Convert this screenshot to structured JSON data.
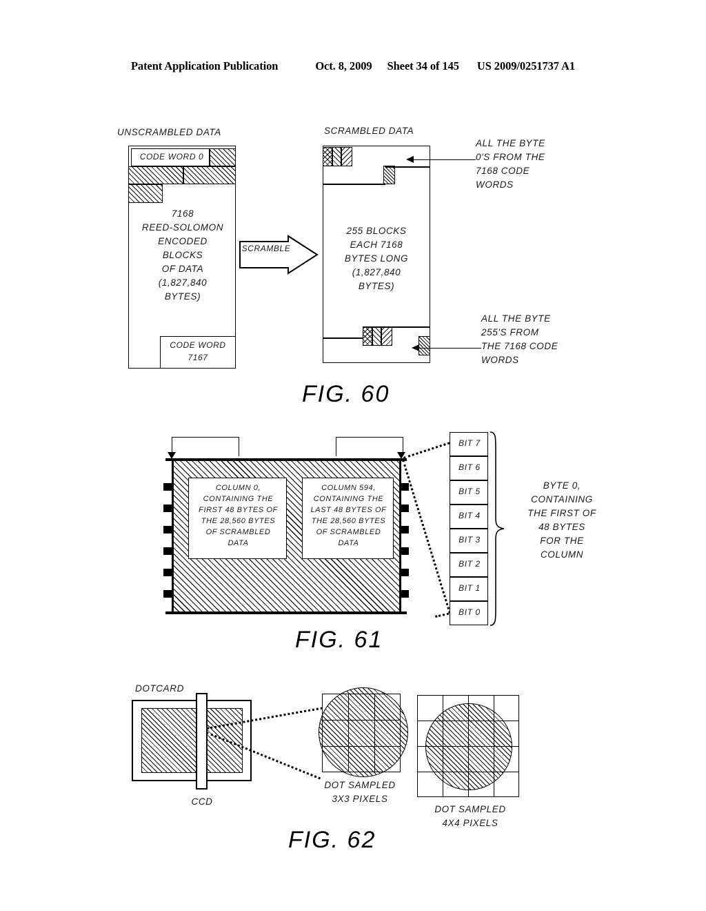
{
  "header": {
    "title": "Patent Application Publication",
    "date": "Oct. 8, 2009",
    "sheet": "Sheet 34 of 145",
    "patent_number": "US 2009/0251737 A1"
  },
  "fig60": {
    "label": "FIG. 60",
    "left_caption": "UNSCRAMBLED DATA",
    "right_caption": "SCRAMBLED DATA",
    "left_top_block_label": "CODE WORD 0",
    "left_body_text": "7168\nREED-SOLOMON\nENCODED\nBLOCKS\nOF DATA\n(1,827,840\nBYTES)",
    "left_bottom_block_label": "CODE WORD\n7167",
    "right_body_text": "255 BLOCKS\nEACH 7168\nBYTES LONG\n(1,827,840\nBYTES)",
    "scramble_arrow_label": "SCRAMBLE",
    "annotation_top": "ALL THE BYTE\n0'S FROM THE\n7168 CODE\nWORDS",
    "annotation_bottom": "ALL THE BYTE\n255'S FROM\nTHE 7168 CODE\nWORDS"
  },
  "fig61": {
    "label": "FIG. 61",
    "column_first_text": "COLUMN 0,\nCONTAINING THE\nFIRST 48 BYTES OF\nTHE 28,560 BYTES\nOF SCRAMBLED\nDATA",
    "column_last_text": "COLUMN 594,\nCONTAINING THE\nLAST 48 BYTES OF\nTHE 28,560 BYTES\nOF SCRAMBLED\nDATA",
    "bits": [
      "BIT 7",
      "BIT 6",
      "BIT 5",
      "BIT 4",
      "BIT 3",
      "BIT 2",
      "BIT 1",
      "BIT 0"
    ],
    "byte_annotation": "BYTE 0,\nCONTAINING\nTHE FIRST OF\n48 BYTES\nFOR THE\nCOLUMN"
  },
  "fig62": {
    "label": "FIG. 62",
    "dotcard_label": "DOTCARD",
    "ccd_label": "CCD",
    "sample3x3_label": "DOT SAMPLED\n3X3 PIXELS",
    "sample4x4_label": "DOT SAMPLED\n4X4 PIXELS"
  },
  "colors": {
    "ink": "#000000",
    "page": "#ffffff"
  }
}
